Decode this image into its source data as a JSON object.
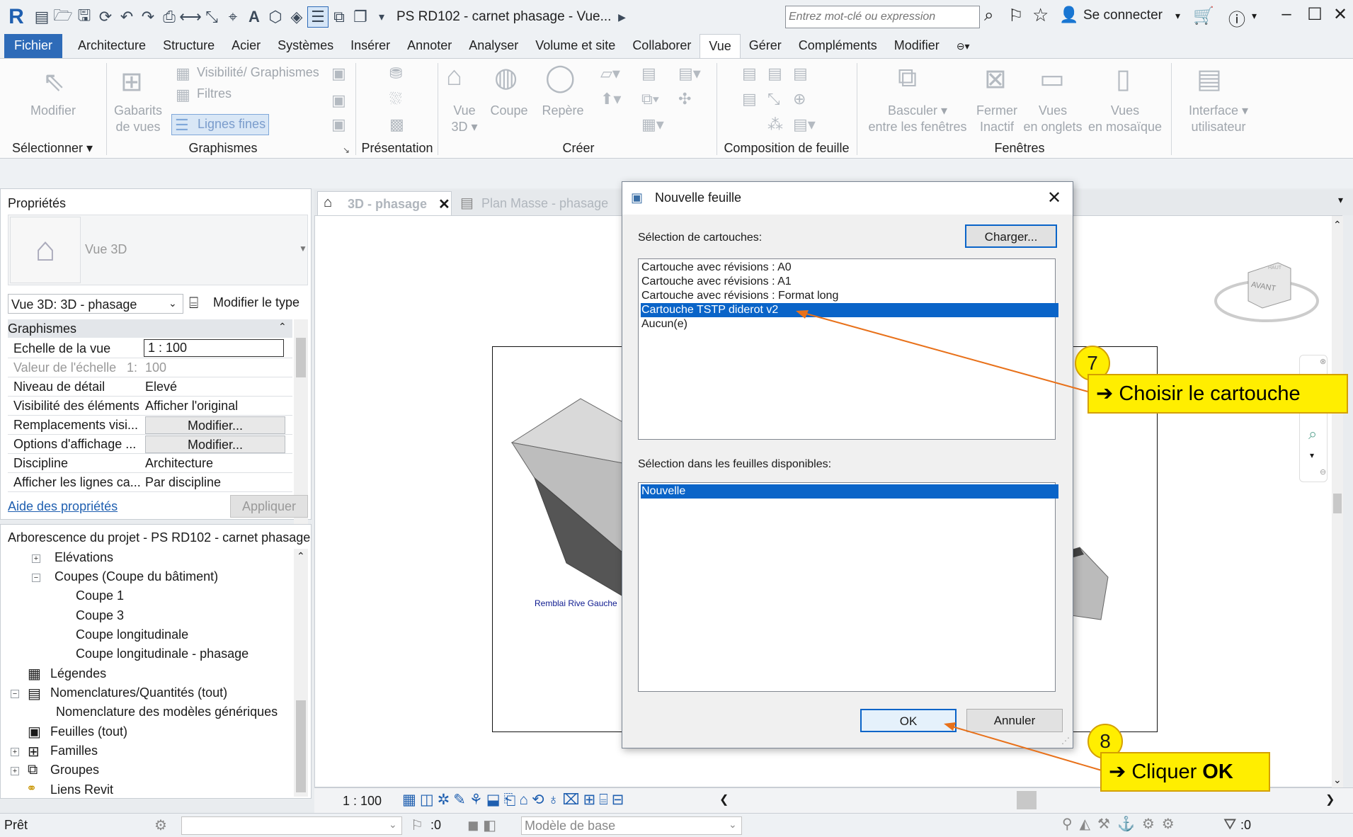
{
  "titlebar": {
    "app_logo": "R",
    "doc_title": "PS RD102 - carnet phasage  - Vue...",
    "search_placeholder": "Entrez mot-clé ou expression",
    "signin": "Se connecter"
  },
  "ribbon_tabs": [
    "Fichier",
    "Architecture",
    "Structure",
    "Acier",
    "Systèmes",
    "Insérer",
    "Annoter",
    "Analyser",
    "Volume et site",
    "Collaborer",
    "Vue",
    "Gérer",
    "Compléments",
    "Modifier"
  ],
  "ribbon": {
    "modifier": "Modifier",
    "gabarits": [
      "Gabarits",
      "de vues"
    ],
    "visibilite": "Visibilité/ Graphismes",
    "filtres": "Filtres",
    "lignes_fines": "Lignes fines",
    "vue3d": [
      "Vue",
      "3D"
    ],
    "coupe": "Coupe",
    "repere": "Repère",
    "basculer": [
      "Basculer",
      "entre les fenêtres"
    ],
    "fermer": [
      "Fermer",
      "Inactif"
    ],
    "vues_onglets": [
      "Vues",
      "en onglets"
    ],
    "vues_mosaique": [
      "Vues",
      "en mosaïque"
    ],
    "interface": [
      "Interface",
      "utilisateur"
    ],
    "panels": {
      "selectionner": "Sélectionner",
      "graphismes": "Graphismes",
      "presentation": "Présentation",
      "creer": "Créer",
      "composition": "Composition de feuille",
      "fenetres": "Fenêtres"
    }
  },
  "properties": {
    "title": "Propriétés",
    "type_name": "Vue 3D",
    "selector": "Vue 3D: 3D - phasage",
    "edit_type": "Modifier le type",
    "group": "Graphismes",
    "rows": [
      {
        "name": "Echelle de la vue",
        "value": "1 : 100"
      },
      {
        "name": "Valeur de l'échelle",
        "value": "100",
        "prefix": "1:"
      },
      {
        "name": "Niveau de détail",
        "value": "Elevé"
      },
      {
        "name": "Visibilité des éléments",
        "value": "Afficher l'original"
      },
      {
        "name": "Remplacements visi...",
        "value": "Modifier..."
      },
      {
        "name": "Options d'affichage ...",
        "value": "Modifier..."
      },
      {
        "name": "Discipline",
        "value": "Architecture"
      },
      {
        "name": "Afficher les lignes ca...",
        "value": "Par discipline"
      }
    ],
    "help": "Aide des propriétés",
    "apply": "Appliquer"
  },
  "project_browser": {
    "title": "Arborescence du projet - PS RD102 - carnet phasage",
    "items": [
      {
        "label": "Elévations"
      },
      {
        "label": "Coupes (Coupe du bâtiment)"
      },
      {
        "label": "Coupe 1"
      },
      {
        "label": "Coupe 3"
      },
      {
        "label": "Coupe longitudinale"
      },
      {
        "label": "Coupe longitudinale - phasage"
      },
      {
        "label": "Légendes"
      },
      {
        "label": "Nomenclatures/Quantités (tout)"
      },
      {
        "label": "Nomenclature des modèles génériques"
      },
      {
        "label": "Feuilles (tout)"
      },
      {
        "label": "Familles"
      },
      {
        "label": "Groupes"
      },
      {
        "label": "Liens Revit"
      }
    ]
  },
  "view_tabs": [
    {
      "label": "3D - phasage"
    },
    {
      "label": "Plan Masse - phasage"
    }
  ],
  "viewport": {
    "annotation": "Remblai Rive Gauche",
    "viewcube_face": "AVANT",
    "viewcube_top": "HAUT",
    "scale": "1 : 100"
  },
  "statusbar": {
    "ready": "Prêt",
    "counter": ":0",
    "model": "Modèle de base",
    "filter_count": ":0"
  },
  "dialog": {
    "title": "Nouvelle feuille",
    "section1": "Sélection de cartouches:",
    "load_button": "Charger...",
    "titleblocks": [
      "Cartouche avec révisions : A0",
      "Cartouche avec révisions : A1",
      "Cartouche avec révisions : Format long",
      "Cartouche TSTP diderot v2",
      "Aucun(e)"
    ],
    "selected_titleblock_index": 3,
    "section2": "Sélection dans les feuilles disponibles:",
    "sheets": [
      "Nouvelle"
    ],
    "ok": "OK",
    "cancel": "Annuler"
  },
  "annotations": {
    "step7_number": "7",
    "step7_text": "Choisir le cartouche",
    "step8_number": "8",
    "step8_text": "Cliquer ",
    "step8_bold": "OK",
    "color_box": "#ffee00",
    "color_arrow": "#e8711a"
  }
}
